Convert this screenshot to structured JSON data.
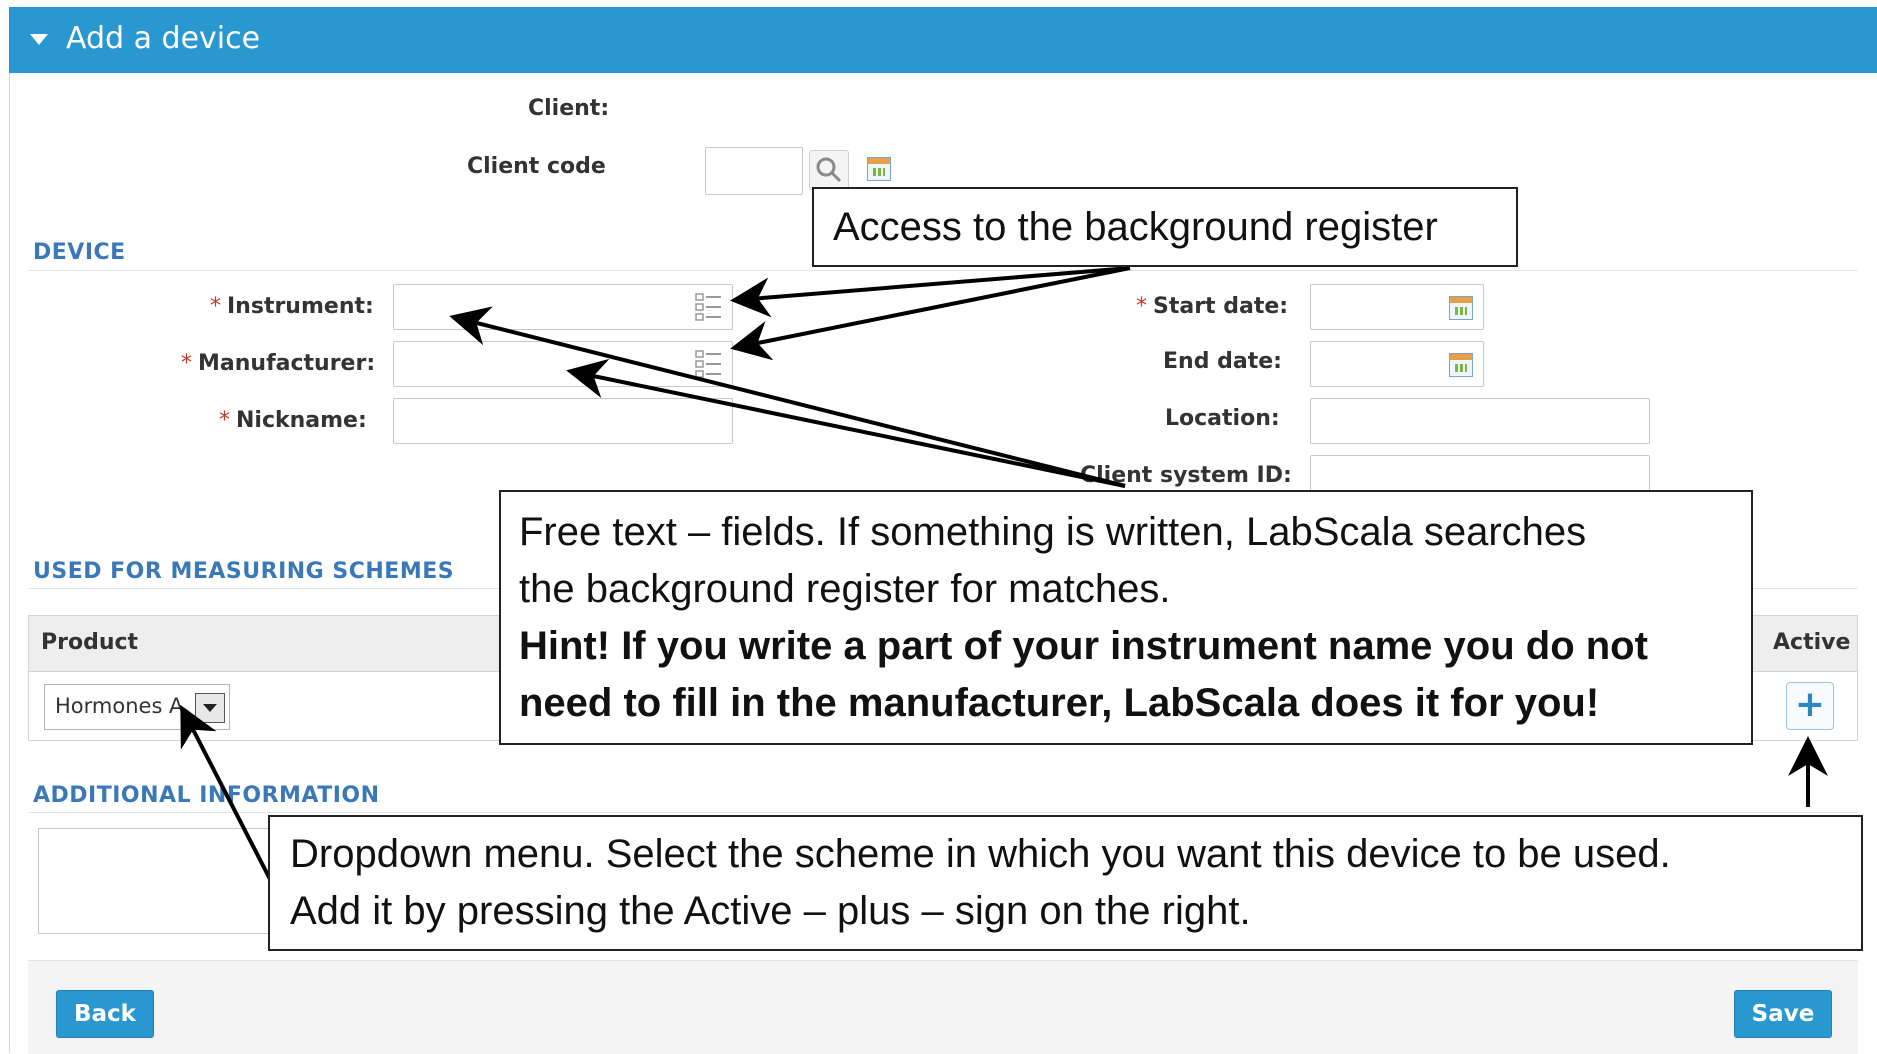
{
  "header": {
    "title": "Add a device"
  },
  "client": {
    "client_label": "Client:",
    "client_code_label": "Client code"
  },
  "device": {
    "section_title": "DEVICE",
    "instrument_label": "Instrument:",
    "manufacturer_label": "Manufacturer:",
    "nickname_label": "Nickname:",
    "start_date_label": "Start date:",
    "end_date_label": "End date:",
    "location_label": "Location:",
    "client_system_id_label": "Client system ID:",
    "required_marker": "*"
  },
  "schemes": {
    "section_title": "USED FOR MEASURING SCHEMES",
    "col_product": "Product",
    "col_active": "Active",
    "product_selected": "Hormones A",
    "add_symbol": "+"
  },
  "additional": {
    "section_title": "ADDITIONAL INFORMATION"
  },
  "footer": {
    "back_label": "Back",
    "save_label": "Save"
  },
  "callouts": {
    "register": "Access to the background register",
    "free_text_line1": "Free text – fields. If something is written, LabScala searches",
    "free_text_line2": "the background register for matches.",
    "hint_line1": "Hint! If you write a part of your instrument name you do not",
    "hint_line2": "need to fill in the manufacturer, LabScala does it for you!",
    "dropdown_line1": "Dropdown menu. Select the scheme in which you want this device to be used.",
    "dropdown_line2": "Add it by pressing the Active – plus – sign on the right."
  },
  "icons": [
    "collapse-triangle-icon",
    "search-icon",
    "calendar-icon",
    "list-icon",
    "plus-icon"
  ]
}
